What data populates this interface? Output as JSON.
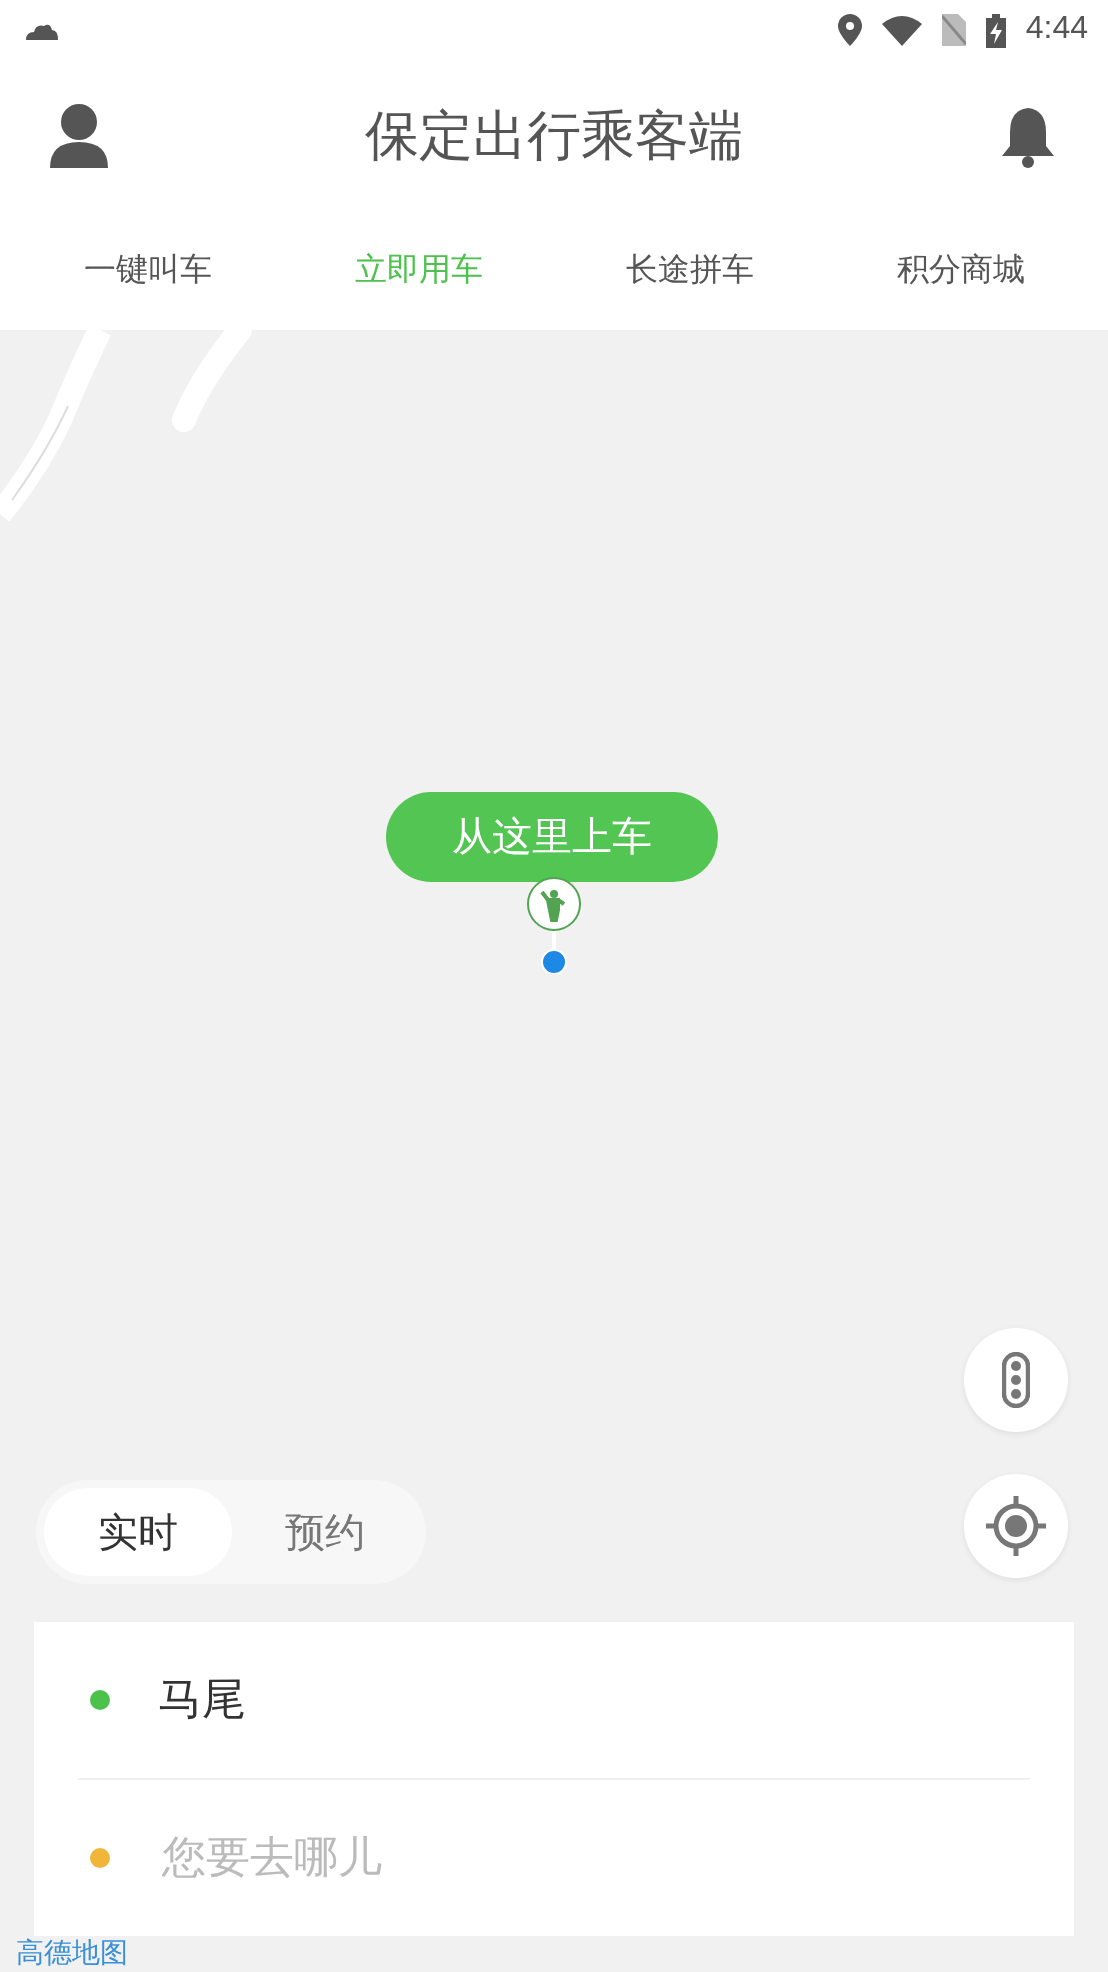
{
  "status_bar": {
    "time": "4:44"
  },
  "header": {
    "title": "保定出行乘客端"
  },
  "tabs": [
    {
      "label": "一键叫车",
      "selected": false
    },
    {
      "label": "立即用车",
      "selected": true
    },
    {
      "label": "长途拼车",
      "selected": false
    },
    {
      "label": "积分商城",
      "selected": false
    }
  ],
  "map": {
    "pickup_label": "从这里上车",
    "logo": "高德地图"
  },
  "mode_switch": [
    {
      "label": "实时",
      "selected": true
    },
    {
      "label": "预约",
      "selected": false
    }
  ],
  "route": [
    {
      "kind": "origin",
      "text": "马尾",
      "color": "#4cc14c"
    },
    {
      "kind": "destination",
      "placeholder": "您要去哪儿",
      "color": "#f0b63a"
    }
  ]
}
